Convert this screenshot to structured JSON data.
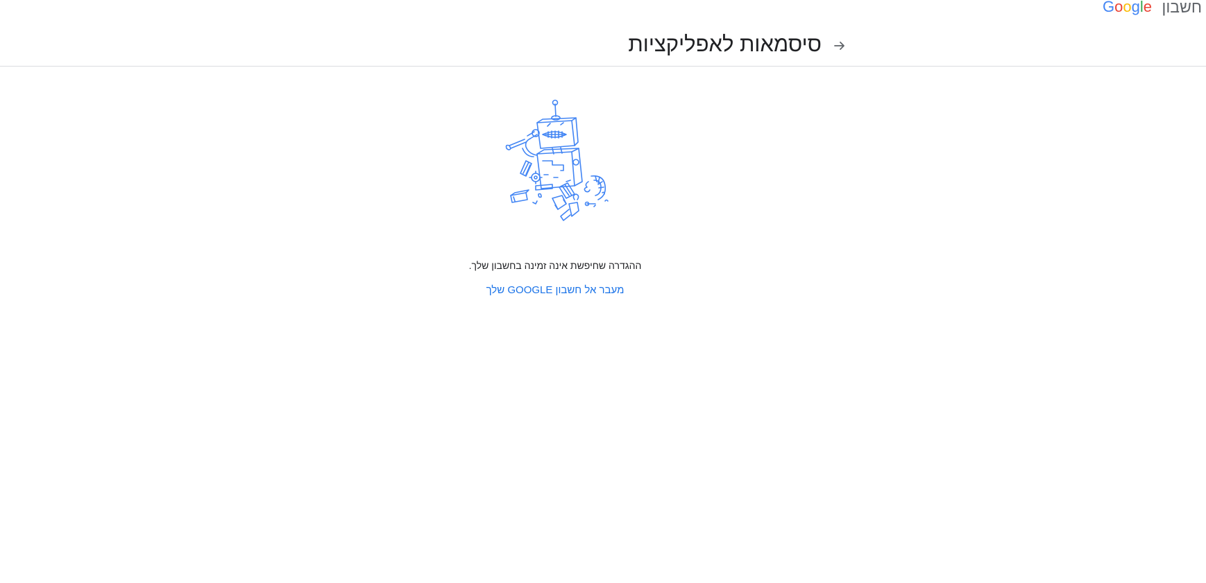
{
  "header": {
    "brand_word": "חשבון",
    "logo_text": "Google",
    "title": "סיסמאות לאפליקציות",
    "back_icon": "arrow-back-icon"
  },
  "main": {
    "illustration": "broken-robot-illustration",
    "message": "ההגדרה שחיפשת אינה זמינה בחשבון שלך.",
    "link_label": "מעבר אל חשבון GOOGLE שלך"
  },
  "colors": {
    "link": "#1a73e8",
    "illustration_stroke": "#4285f4",
    "divider": "#dadce0",
    "google_blue": "#4285f4",
    "google_red": "#ea4335",
    "google_yellow": "#fbbc05",
    "google_green": "#34a853"
  }
}
